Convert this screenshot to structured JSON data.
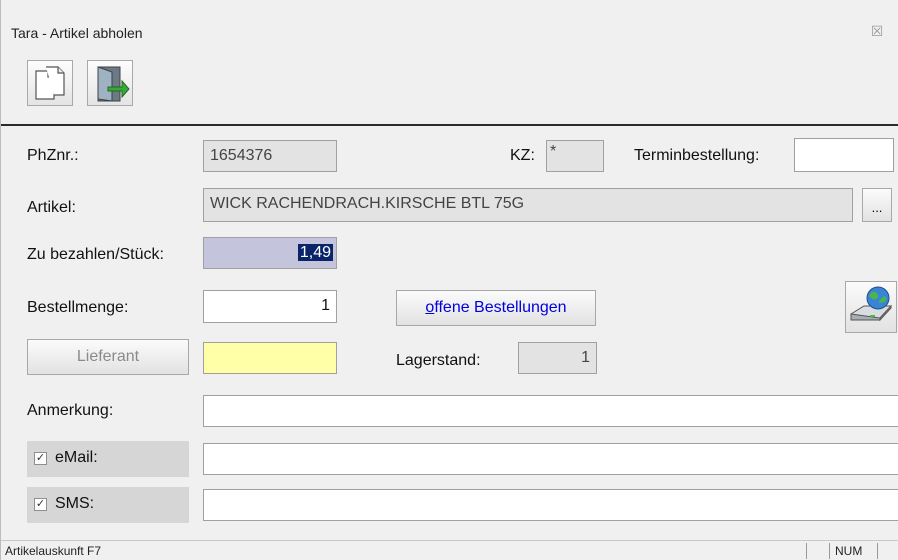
{
  "window": {
    "title": "Tara - Artikel abholen",
    "close_glyph": "☒"
  },
  "toolbar": {
    "buttons": [
      {
        "icon": "copy-documents-icon"
      },
      {
        "icon": "exit-door-icon"
      }
    ]
  },
  "form": {
    "phznr_label": "PhZnr.:",
    "phznr_value": "1654376",
    "kz_label": "KZ:",
    "kz_value": "*",
    "termin_label": "Terminbestellung:",
    "termin_value": "",
    "artikel_label": "Artikel:",
    "artikel_value": "WICK RACHENDRACH.KIRSCHE BTL 75G",
    "artikel_browse": "...",
    "zubezahlen_label": "Zu bezahlen/Stück:",
    "zubezahlen_value": "1,49",
    "bestellmenge_label": "Bestellmenge:",
    "bestellmenge_value": "1",
    "offene_prefix": "o",
    "offene_rest": "ffene Bestellungen",
    "lieferant_button": "Lieferant",
    "lieferant_value": "",
    "lagerstand_label": "Lagerstand:",
    "lagerstand_value": "1",
    "anmerkung_label": "Anmerkung:",
    "anmerkung_value": "",
    "email_label": "eMail:",
    "email_checked": "✓",
    "email_value": "",
    "sms_label": "SMS:",
    "sms_checked": "✓",
    "sms_value": ""
  },
  "statusbar": {
    "text": "Artikelauskunft F7",
    "num": "NUM"
  },
  "colors": {
    "purple_field": "#c4c4dd",
    "yellow_field": "#ffffa8",
    "link_blue": "#0000e0"
  }
}
